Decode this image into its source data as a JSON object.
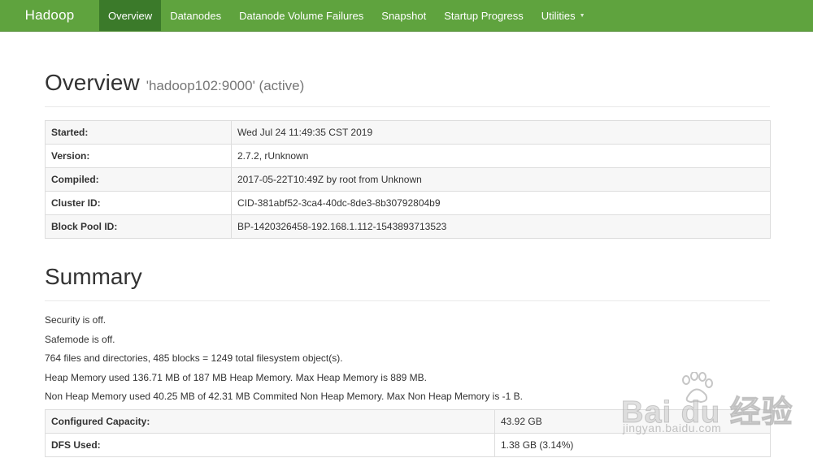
{
  "navbar": {
    "brand": "Hadoop",
    "items": [
      {
        "label": "Overview",
        "active": true
      },
      {
        "label": "Datanodes",
        "active": false
      },
      {
        "label": "Datanode Volume Failures",
        "active": false
      },
      {
        "label": "Snapshot",
        "active": false
      },
      {
        "label": "Startup Progress",
        "active": false
      },
      {
        "label": "Utilities",
        "active": false,
        "dropdown": true
      }
    ],
    "bg_color": "#5fa33e",
    "active_color": "#3b7a2a"
  },
  "overview": {
    "title": "Overview",
    "subtitle": "'hadoop102:9000' (active)",
    "rows": [
      {
        "key": "Started:",
        "value": "Wed Jul 24 11:49:35 CST 2019"
      },
      {
        "key": "Version:",
        "value": "2.7.2, rUnknown"
      },
      {
        "key": "Compiled:",
        "value": "2017-05-22T10:49Z by root from Unknown"
      },
      {
        "key": "Cluster ID:",
        "value": "CID-381abf52-3ca4-40dc-8de3-8b30792804b9"
      },
      {
        "key": "Block Pool ID:",
        "value": "BP-1420326458-192.168.1.112-1543893713523"
      }
    ]
  },
  "summary": {
    "title": "Summary",
    "lines": [
      "Security is off.",
      "Safemode is off.",
      "764 files and directories, 485 blocks = 1249 total filesystem object(s).",
      "Heap Memory used 136.71 MB of 187 MB Heap Memory. Max Heap Memory is 889 MB.",
      "Non Heap Memory used 40.25 MB of 42.31 MB Commited Non Heap Memory. Max Non Heap Memory is -1 B."
    ],
    "rows": [
      {
        "key": "Configured Capacity:",
        "value": "43.92 GB"
      },
      {
        "key": "DFS Used:",
        "value": "1.38 GB (3.14%)"
      }
    ]
  },
  "watermark": {
    "text": "Bai du 经验",
    "url": "jingyan.baidu.com",
    "icon": "paw-icon"
  }
}
